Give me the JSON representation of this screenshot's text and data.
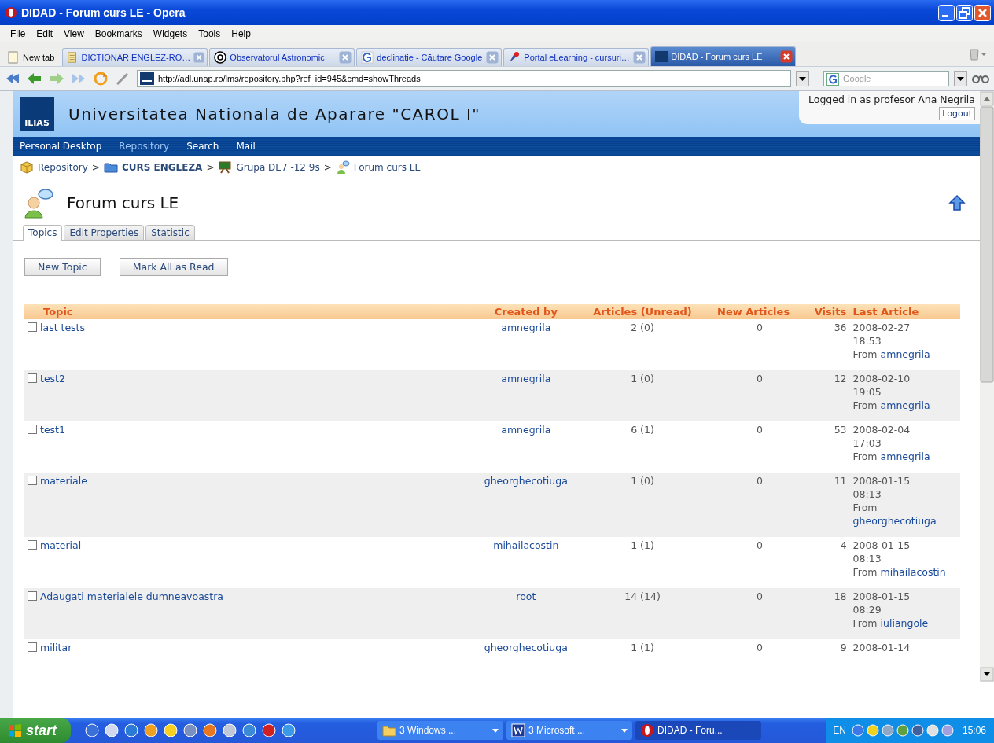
{
  "window": {
    "title": "DIDAD - Forum curs LE - Opera"
  },
  "menu": [
    "File",
    "Edit",
    "View",
    "Bookmarks",
    "Widgets",
    "Tools",
    "Help"
  ],
  "tabs": [
    {
      "kind": "new",
      "label": "New tab",
      "selected": false
    },
    {
      "kind": "page",
      "label": "DICTIONAR ENGLEZ-RO…",
      "selected": false
    },
    {
      "kind": "page",
      "label": "Observatorul Astronomic",
      "selected": false
    },
    {
      "kind": "page",
      "label": "declinatie - Căutare Google",
      "selected": false
    },
    {
      "kind": "page",
      "label": "Portal eLearning - cursuri…",
      "selected": false
    },
    {
      "kind": "page",
      "label": "DIDAD - Forum curs LE",
      "selected": true
    }
  ],
  "address": {
    "url": "http://adl.unap.ro/lms/repository.php?ref_id=945&cmd=showThreads"
  },
  "search": {
    "placeholder": "Google"
  },
  "site": {
    "logo": "ILIAS",
    "title": "Universitatea Nationala de Aparare \"CAROL I\"",
    "login_text": "Logged in as profesor Ana Negrila",
    "logout": "Logout",
    "nav": [
      {
        "label": "Personal Desktop",
        "selected": false
      },
      {
        "label": "Repository",
        "selected": true
      },
      {
        "label": "Search",
        "selected": false
      },
      {
        "label": "Mail",
        "selected": false
      }
    ],
    "breadcrumb": [
      {
        "label": "Repository",
        "emphasized": false
      },
      {
        "label": "CURS ENGLEZA",
        "emphasized": true
      },
      {
        "label": "Grupa DE7 -12 9s",
        "emphasized": false
      },
      {
        "label": "Forum curs LE",
        "emphasized": false
      }
    ],
    "breadcrumb_separator": ">",
    "page_title": "Forum curs LE",
    "tabs": [
      {
        "label": "Topics",
        "selected": true
      },
      {
        "label": "Edit Properties",
        "selected": false
      },
      {
        "label": "Statistic",
        "selected": false
      }
    ],
    "buttons": [
      "New Topic",
      "Mark All as Read"
    ],
    "table": {
      "columns": [
        "Topic",
        "Created by",
        "Articles (Unread)",
        "New Articles",
        "Visits",
        "Last Article"
      ],
      "rows": [
        {
          "checked": false,
          "topic": "last tests",
          "created_by": "amnegrila",
          "articles": "2 (0)",
          "new_articles": "0",
          "visits": "36",
          "last_article": "2008-02-27 18:53",
          "from_label": "From",
          "from": "amnegrila"
        },
        {
          "checked": false,
          "topic": "test2",
          "created_by": "amnegrila",
          "articles": "1 (0)",
          "new_articles": "0",
          "visits": "12",
          "last_article": "2008-02-10 19:05",
          "from_label": "From",
          "from": "amnegrila"
        },
        {
          "checked": false,
          "topic": "test1",
          "created_by": "amnegrila",
          "articles": "6 (1)",
          "new_articles": "0",
          "visits": "53",
          "last_article": "2008-02-04 17:03",
          "from_label": "From",
          "from": "amnegrila"
        },
        {
          "checked": false,
          "topic": "materiale",
          "created_by": "gheorghecotiuga",
          "articles": "1 (0)",
          "new_articles": "0",
          "visits": "11",
          "last_article": "2008-01-15 08:13",
          "from_label": "From",
          "from": "gheorghecotiuga"
        },
        {
          "checked": false,
          "topic": "material",
          "created_by": "mihailacostin",
          "articles": "1 (1)",
          "new_articles": "0",
          "visits": "4",
          "last_article": "2008-01-15 08:13",
          "from_label": "From",
          "from": "mihailacostin"
        },
        {
          "checked": false,
          "topic": "Adaugati materialele dumneavoastra",
          "created_by": "root",
          "articles": "14 (14)",
          "new_articles": "0",
          "visits": "18",
          "last_article": "2008-01-15 08:29",
          "from_label": "From",
          "from": "iuliangole"
        },
        {
          "checked": false,
          "topic": "militar",
          "created_by": "gheorghecotiuga",
          "articles": "1 (1)",
          "new_articles": "0",
          "visits": "9",
          "last_article": "2008-01-14"
        }
      ]
    }
  },
  "taskbar": {
    "start": "start",
    "tasks": [
      {
        "label": "3 Windows ...",
        "selected": false
      },
      {
        "label": "3 Microsoft ...",
        "selected": false
      },
      {
        "label": "DIDAD - Foru...",
        "selected": true
      }
    ],
    "language": "EN",
    "clock": "15:06"
  }
}
